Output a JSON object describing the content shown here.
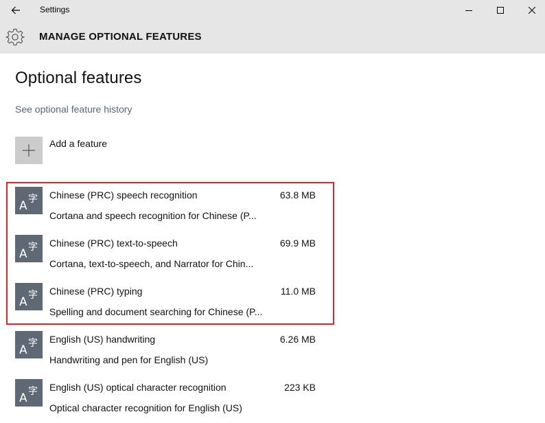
{
  "window": {
    "title": "Settings"
  },
  "header": {
    "title": "MANAGE OPTIONAL FEATURES",
    "icon": "gear-icon"
  },
  "page": {
    "title": "Optional features",
    "history_link": "See optional feature history",
    "add_feature_label": "Add a feature"
  },
  "features": [
    {
      "name": "Chinese (PRC) speech recognition",
      "size": "63.8 MB",
      "description": "Cortana and speech recognition for Chinese (P..."
    },
    {
      "name": "Chinese (PRC) text-to-speech",
      "size": "69.9 MB",
      "description": "Cortana, text-to-speech, and Narrator for Chin..."
    },
    {
      "name": "Chinese (PRC) typing",
      "size": "11.0 MB",
      "description": "Spelling and document searching for Chinese (P..."
    },
    {
      "name": "English (US) handwriting",
      "size": "6.26 MB",
      "description": "Handwriting and pen for English (US)"
    },
    {
      "name": "English (US) optical character recognition",
      "size": "223 KB",
      "description": "Optical character recognition for English (US)"
    }
  ],
  "colors": {
    "chrome": "#e6e6e6",
    "feature_icon_bg": "#5f6975",
    "link": "#56667a",
    "highlight": "#e0232b"
  }
}
